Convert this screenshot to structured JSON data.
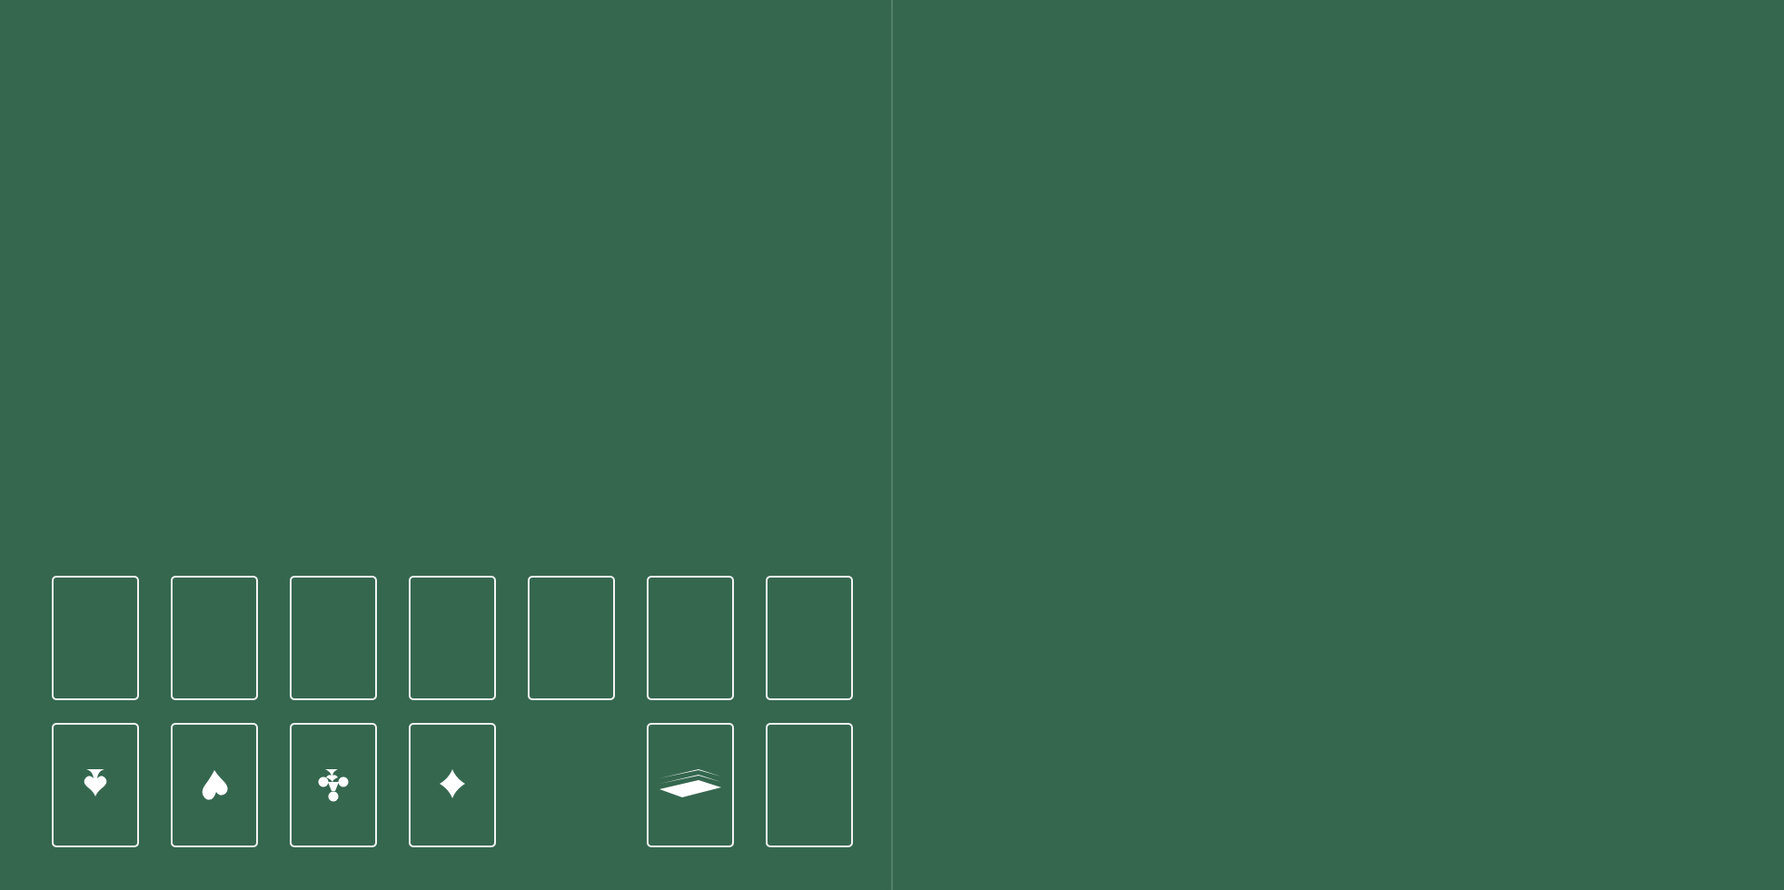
{
  "colors": {
    "felt": "#35674f",
    "outline": "#f2f5f3",
    "divider": "#52806a"
  },
  "tableau": [
    {
      "name": "tableau-pile-1"
    },
    {
      "name": "tableau-pile-2"
    },
    {
      "name": "tableau-pile-3"
    },
    {
      "name": "tableau-pile-4"
    },
    {
      "name": "tableau-pile-5"
    },
    {
      "name": "tableau-pile-6"
    },
    {
      "name": "tableau-pile-7"
    }
  ],
  "foundations": [
    {
      "suit": "spades",
      "icon": "spade-outline-icon"
    },
    {
      "suit": "spades",
      "icon": "spade-icon"
    },
    {
      "suit": "clubs",
      "icon": "club-icon"
    },
    {
      "suit": "diamonds",
      "icon": "diamond-icon"
    }
  ],
  "stock": {
    "icon": "card-stack-icon"
  },
  "waste": {
    "icon": ""
  }
}
